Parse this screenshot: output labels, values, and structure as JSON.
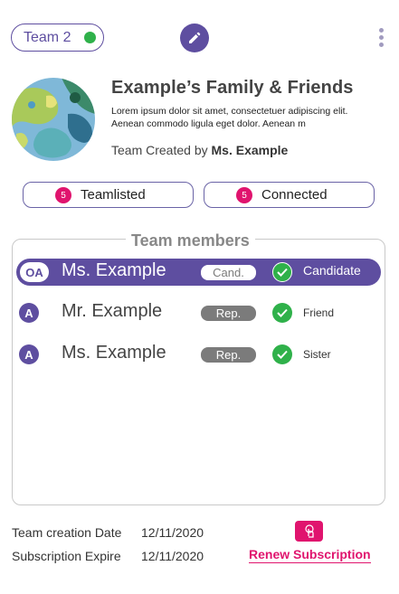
{
  "header": {
    "team_badge": "Team 2",
    "team_status_color": "#2fb14a"
  },
  "family": {
    "title": "Example’s Family & Friends",
    "description": "Lorem ipsum dolor sit amet, consectetuer adipiscing elit. Aenean commodo ligula eget dolor. Aenean m",
    "created_prefix": "Team Created by",
    "created_by": "Ms. Example"
  },
  "actions": {
    "teamlisted": {
      "count": "5",
      "label": "Teamlisted"
    },
    "connected": {
      "count": "5",
      "label": "Connected"
    }
  },
  "members": {
    "title": "Team members",
    "rows": [
      {
        "role": "OA",
        "name": "Ms. Example",
        "type": "Cand.",
        "relation": "Candidate"
      },
      {
        "role": "A",
        "name": "Mr. Example",
        "type": "Rep.",
        "relation": "Friend"
      },
      {
        "role": "A",
        "name": "Ms. Example",
        "type": "Rep.",
        "relation": "Sister"
      }
    ]
  },
  "footer": {
    "creation_label": "Team creation Date",
    "creation_date": "12/11/2020",
    "expire_label": "Subscription Expire",
    "expire_date": "12/11/2020",
    "renew_label": "Renew Subscription"
  },
  "colors": {
    "brand": "#5e4ea0",
    "accent": "#e0146e",
    "success": "#2fb14a"
  },
  "icons": [
    "pencil-icon",
    "kebab-menu-icon",
    "check-icon",
    "tap-icon"
  ]
}
